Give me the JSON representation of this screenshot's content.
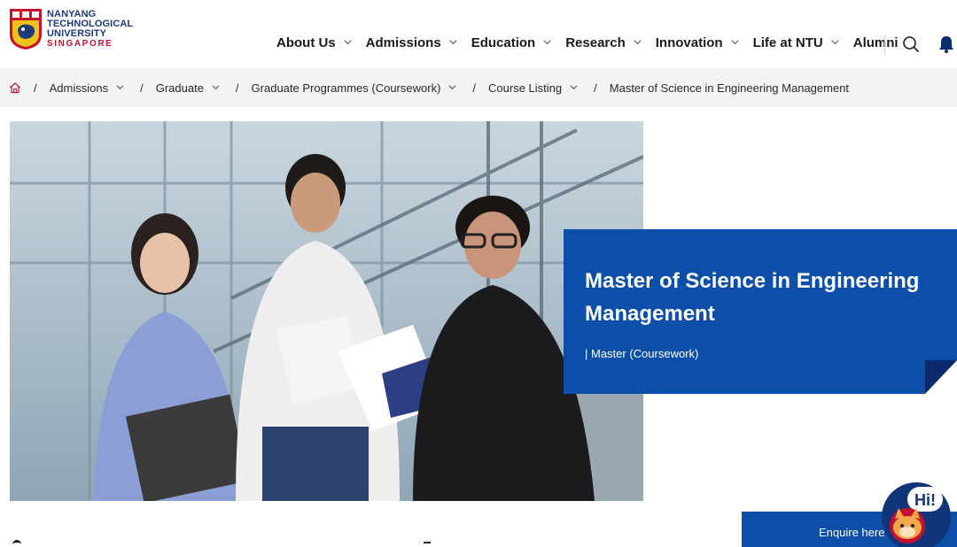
{
  "logo": {
    "line1": "NANYANG",
    "line2": "TECHNOLOGICAL",
    "line3": "UNIVERSITY",
    "line4": "SINGAPORE"
  },
  "nav": {
    "items": [
      {
        "label": "About Us",
        "dropdown": true
      },
      {
        "label": "Admissions",
        "dropdown": true
      },
      {
        "label": "Education",
        "dropdown": true
      },
      {
        "label": "Research",
        "dropdown": true
      },
      {
        "label": "Innovation",
        "dropdown": true
      },
      {
        "label": "Life at NTU",
        "dropdown": true
      },
      {
        "label": "Alumni",
        "dropdown": false
      }
    ]
  },
  "breadcrumb": {
    "items": [
      {
        "label": "Admissions"
      },
      {
        "label": "Graduate"
      },
      {
        "label": "Graduate Programmes (Coursework)"
      },
      {
        "label": "Course Listing"
      }
    ],
    "current": "Master of Science in Engineering Management"
  },
  "hero": {
    "title": "Master of Science in Engineering Management",
    "subtitle": "| Master (Coursework)"
  },
  "enquire": {
    "label": "Enquire here"
  },
  "chat": {
    "bubble": "Hi!"
  },
  "colors": {
    "brand_blue": "#0b4fa8",
    "brand_navy": "#1f3a7a",
    "brand_red": "#c4122f",
    "breadcrumb_bg": "#f3f3f3"
  }
}
